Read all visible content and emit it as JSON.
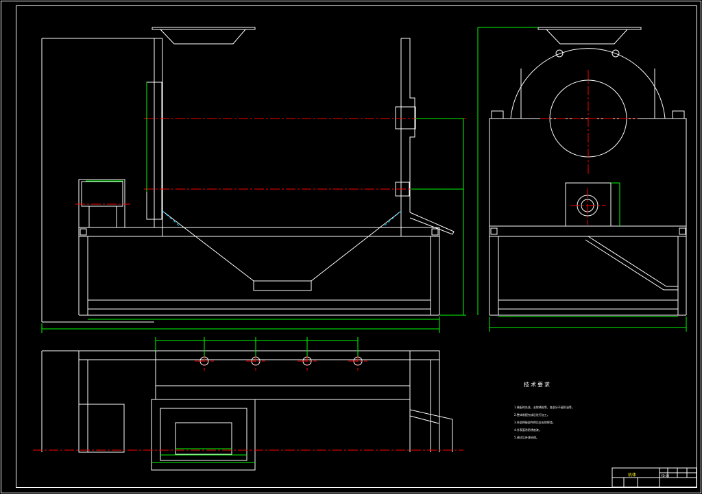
{
  "notes": {
    "title": "技术要求",
    "items": [
      "1.装配时先洗，去除锈斑等，各部分不留积油等。",
      "2.整体装配完成后进行加工。",
      "3.外部焊接部件焊后应去除焊渣。",
      "4.外表面涂防锈底漆。",
      "5.调试后补漆处理。"
    ]
  },
  "title_block": {
    "name": "机体",
    "code": "YD-00"
  },
  "colors": {
    "background": "#000000",
    "outline": "#ffffff",
    "dimension": "#00ff00",
    "centerline": "#ff0000",
    "hidden": "#00c8ff"
  }
}
